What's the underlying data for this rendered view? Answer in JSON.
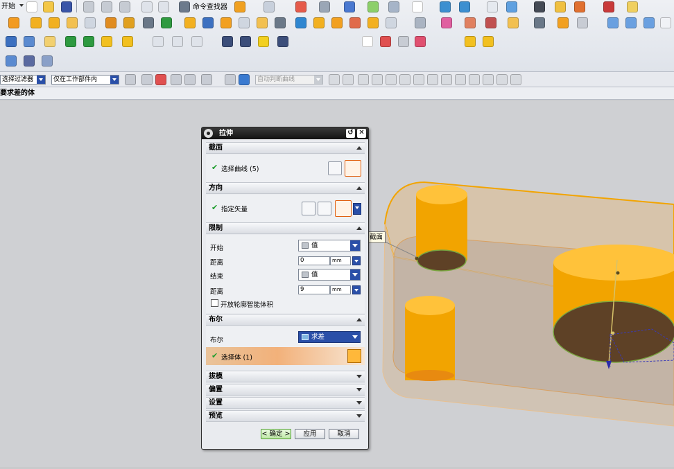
{
  "menu": {
    "start_label": "开始"
  },
  "toolbar": {
    "command_finder_label": "命令查找器"
  },
  "selection_bar": {
    "filter_label": "选择过滤器",
    "scope_label": "仅在工作部件内",
    "curve_rule_label": "自动判断曲线"
  },
  "status": {
    "prompt": "要求差的体"
  },
  "dialog": {
    "title": "拉伸",
    "reset_glyph": "↺",
    "close_glyph": "✕",
    "sections": {
      "section": {
        "title": "截面",
        "select_curve_label": "选择曲线 (5)"
      },
      "direction": {
        "title": "方向",
        "specify_vector_label": "指定矢量"
      },
      "limits": {
        "title": "限制",
        "start_label": "开始",
        "start_type": "值",
        "start_distance_label": "距离",
        "start_distance_value": "0",
        "start_distance_unit": "mm",
        "end_label": "结束",
        "end_type": "值",
        "end_distance_label": "距离",
        "end_distance_value": "9",
        "end_distance_unit": "mm",
        "open_profile_label": "开放轮廓智能体积"
      },
      "boolean": {
        "title": "布尔",
        "boolean_label": "布尔",
        "boolean_value": "求差",
        "select_body_label": "选择体 (1)"
      },
      "draft": {
        "title": "拔模"
      },
      "offset": {
        "title": "偏置"
      },
      "settings": {
        "title": "设置"
      },
      "preview": {
        "title": "预览"
      }
    },
    "buttons": {
      "ok": "< 确定 >",
      "apply": "应用",
      "cancel": "取消"
    }
  },
  "viewport": {
    "tooltip_label": "截面"
  },
  "colors": {
    "accent_blue": "#2a4fa8",
    "cylinder_orange": "#f2a400",
    "check_green": "#1f9e2e"
  }
}
